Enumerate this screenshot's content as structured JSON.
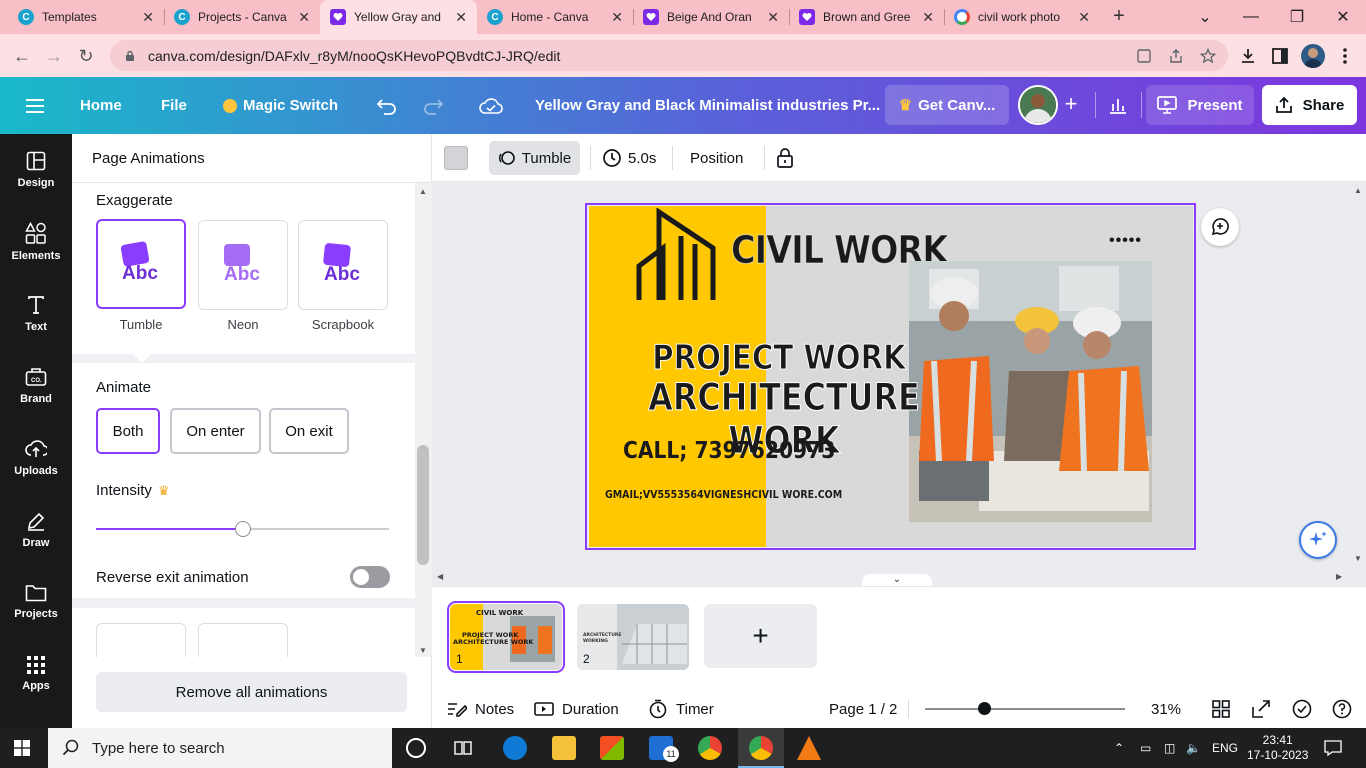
{
  "browser": {
    "tabs": [
      {
        "title": "Templates",
        "icon": "canva-icon",
        "active": false
      },
      {
        "title": "Projects - Canva",
        "icon": "canva-icon",
        "active": false
      },
      {
        "title": "Yellow Gray and",
        "icon": "canva-heart-icon",
        "active": true
      },
      {
        "title": "Home - Canva",
        "icon": "canva-icon",
        "active": false
      },
      {
        "title": "Beige And Oran",
        "icon": "canva-heart-icon",
        "active": false
      },
      {
        "title": "Brown and Gree",
        "icon": "canva-heart-icon",
        "active": false
      },
      {
        "title": "civil work photo",
        "icon": "google-icon",
        "active": false
      }
    ],
    "url": "canva.com/design/DAFxlv_r8yM/nooQsKHevoPQBvdtCJ-JRQ/edit",
    "colors": {
      "tabstrip": "#f8bfc6",
      "toolbar": "#fde0e3"
    }
  },
  "topbar": {
    "home": "Home",
    "file": "File",
    "magic_switch": "Magic Switch",
    "doc_title": "Yellow Gray and Black Minimalist industries Pr...",
    "get_canva": "Get Canv...",
    "present": "Present",
    "share": "Share"
  },
  "rail": [
    {
      "label": "Design",
      "icon": "design-icon"
    },
    {
      "label": "Elements",
      "icon": "elements-icon"
    },
    {
      "label": "Text",
      "icon": "text-icon"
    },
    {
      "label": "Brand",
      "icon": "brand-icon"
    },
    {
      "label": "Uploads",
      "icon": "upload-icon"
    },
    {
      "label": "Draw",
      "icon": "draw-icon"
    },
    {
      "label": "Projects",
      "icon": "folder-icon"
    },
    {
      "label": "Apps",
      "icon": "apps-icon"
    }
  ],
  "panel": {
    "title": "Page Animations",
    "exaggerate_label": "Exaggerate",
    "animations": [
      {
        "label": "Tumble",
        "selected": true
      },
      {
        "label": "Neon",
        "selected": false
      },
      {
        "label": "Scrapbook",
        "selected": false
      }
    ],
    "animate_label": "Animate",
    "animate_options": [
      {
        "label": "Both",
        "selected": true
      },
      {
        "label": "On enter",
        "selected": false
      },
      {
        "label": "On exit",
        "selected": false
      }
    ],
    "intensity_label": "Intensity",
    "intensity_value": 0.5,
    "reverse_label": "Reverse exit animation",
    "reverse_on": false,
    "remove_all": "Remove all animations"
  },
  "context_toolbar": {
    "animation": "Tumble",
    "duration": "5.0s",
    "position": "Position"
  },
  "design": {
    "heading": "CIVIL WORK",
    "dots": "•••••",
    "line1": "PROJECT WORK",
    "line2": "ARCHITECTURE WORK",
    "call": "CALL; 7397620973",
    "email": "GMAIL;VV5553564VIGNESHCIVIL WORE.COM",
    "accent_color": "#ffc800"
  },
  "pages": [
    {
      "num": "1",
      "selected": true
    },
    {
      "num": "2",
      "selected": false
    }
  ],
  "footer": {
    "notes": "Notes",
    "duration": "Duration",
    "timer": "Timer",
    "page": "Page 1 / 2",
    "zoom": "31%"
  },
  "taskbar": {
    "search_placeholder": "Type here to search",
    "lang": "ENG",
    "time": "23:41",
    "date": "17-10-2023",
    "mail_badge": "11"
  }
}
